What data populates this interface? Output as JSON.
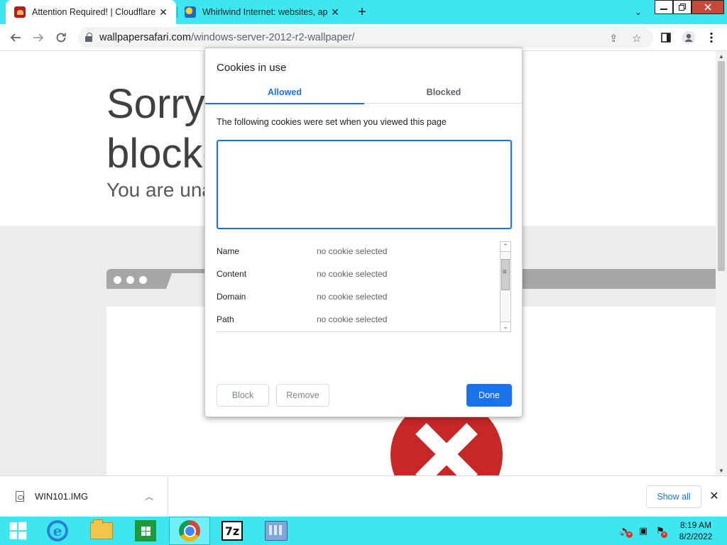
{
  "browser": {
    "tabs": [
      {
        "title": "Attention Required! | Cloudflare",
        "favicon": "cloudflare-icon",
        "active": true
      },
      {
        "title": "Whirlwind Internet: websites, ap",
        "favicon": "whirlwind-icon",
        "active": false
      }
    ],
    "new_tab_label": "+",
    "url_host": "wallpapersafari.com",
    "url_path": "/windows-server-2012-r2-wallpaper/"
  },
  "page": {
    "title_line1": "Sorry,",
    "title_line2": "blocke",
    "subtitle": "You are una"
  },
  "dialog": {
    "title": "Cookies in use",
    "tabs": {
      "allowed": "Allowed",
      "blocked": "Blocked"
    },
    "description": "The following cookies were set when you viewed this page",
    "details": [
      {
        "key": "Name",
        "value": "no cookie selected"
      },
      {
        "key": "Content",
        "value": "no cookie selected"
      },
      {
        "key": "Domain",
        "value": "no cookie selected"
      },
      {
        "key": "Path",
        "value": "no cookie selected"
      }
    ],
    "buttons": {
      "block": "Block",
      "remove": "Remove",
      "done": "Done"
    }
  },
  "download_shelf": {
    "file_name": "WIN101.IMG",
    "show_all": "Show all"
  },
  "taskbar": {
    "time": "8:19 AM",
    "date": "8/2/2022",
    "apps": [
      "start-button",
      "internet-explorer",
      "file-explorer",
      "store",
      "chrome",
      "7zip",
      "control-panel"
    ]
  },
  "colors": {
    "accent": "#1a73e8",
    "taskbar": "#3ee6f0",
    "error_red": "#c62828"
  }
}
